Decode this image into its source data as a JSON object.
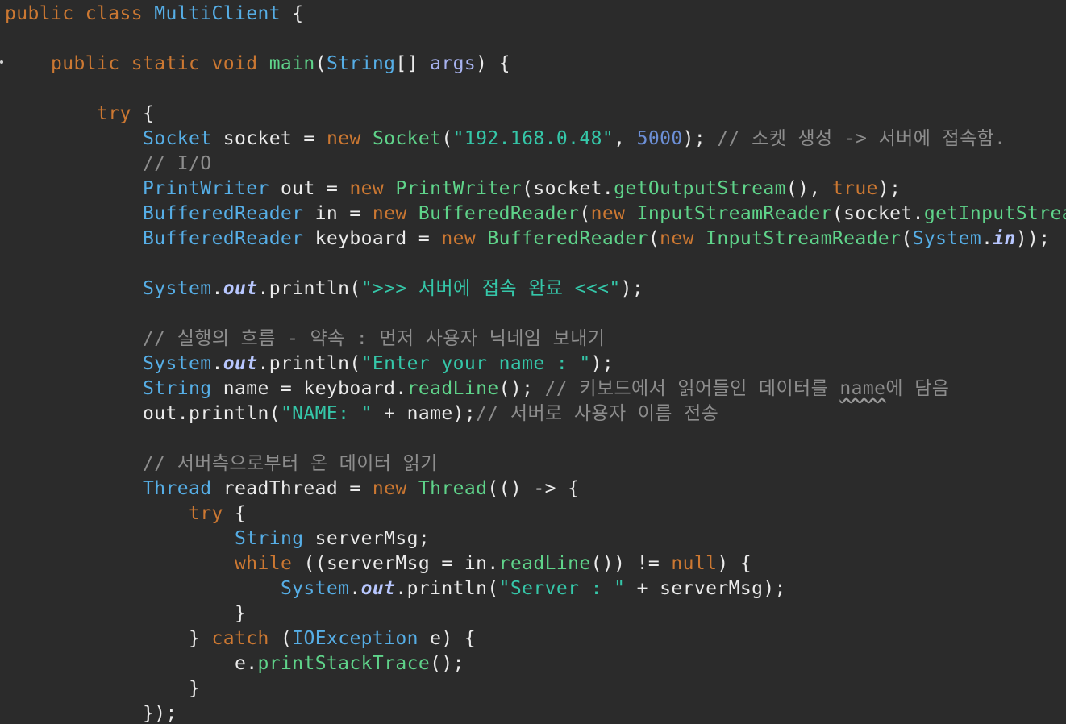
{
  "editor": {
    "lines": [
      [
        {
          "t": "public class ",
          "c": "kw"
        },
        {
          "t": "MultiClient",
          "c": "cls"
        },
        {
          "t": " {",
          "c": "plain"
        }
      ],
      [],
      [
        {
          "t": "    public static void ",
          "c": "kw"
        },
        {
          "t": "main",
          "c": "fn"
        },
        {
          "t": "(",
          "c": "plain"
        },
        {
          "t": "String",
          "c": "cls"
        },
        {
          "t": "[] ",
          "c": "plain"
        },
        {
          "t": "args",
          "c": "param"
        },
        {
          "t": ") {",
          "c": "plain"
        }
      ],
      [],
      [
        {
          "t": "        try",
          "c": "kw"
        },
        {
          "t": " {",
          "c": "plain"
        }
      ],
      [
        {
          "t": "            ",
          "c": "plain"
        },
        {
          "t": "Socket",
          "c": "cls"
        },
        {
          "t": " socket = ",
          "c": "plain"
        },
        {
          "t": "new ",
          "c": "kw"
        },
        {
          "t": "Socket",
          "c": "mth"
        },
        {
          "t": "(",
          "c": "plain"
        },
        {
          "t": "\"192.168.0.48\"",
          "c": "str"
        },
        {
          "t": ", ",
          "c": "plain"
        },
        {
          "t": "5000",
          "c": "num"
        },
        {
          "t": "); ",
          "c": "plain"
        },
        {
          "t": "// 소켓 생성 -> 서버에 접속함.",
          "c": "cmt"
        }
      ],
      [
        {
          "t": "            ",
          "c": "plain"
        },
        {
          "t": "// I/O",
          "c": "cmt"
        }
      ],
      [
        {
          "t": "            ",
          "c": "plain"
        },
        {
          "t": "PrintWriter",
          "c": "cls"
        },
        {
          "t": " out = ",
          "c": "plain"
        },
        {
          "t": "new ",
          "c": "kw"
        },
        {
          "t": "PrintWriter",
          "c": "mth"
        },
        {
          "t": "(socket.",
          "c": "plain"
        },
        {
          "t": "getOutputStream",
          "c": "mth"
        },
        {
          "t": "(), ",
          "c": "plain"
        },
        {
          "t": "true",
          "c": "kw"
        },
        {
          "t": ");",
          "c": "plain"
        }
      ],
      [
        {
          "t": "            ",
          "c": "plain"
        },
        {
          "t": "BufferedReader",
          "c": "cls"
        },
        {
          "t": " in = ",
          "c": "plain"
        },
        {
          "t": "new ",
          "c": "kw"
        },
        {
          "t": "BufferedReader",
          "c": "mth"
        },
        {
          "t": "(",
          "c": "plain"
        },
        {
          "t": "new ",
          "c": "kw"
        },
        {
          "t": "InputStreamReader",
          "c": "mth"
        },
        {
          "t": "(socket.",
          "c": "plain"
        },
        {
          "t": "getInputStream",
          "c": "mth"
        },
        {
          "t": "()));",
          "c": "plain"
        }
      ],
      [
        {
          "t": "            ",
          "c": "plain"
        },
        {
          "t": "BufferedReader",
          "c": "cls"
        },
        {
          "t": " keyboard = ",
          "c": "plain"
        },
        {
          "t": "new ",
          "c": "kw"
        },
        {
          "t": "BufferedReader",
          "c": "mth"
        },
        {
          "t": "(",
          "c": "plain"
        },
        {
          "t": "new ",
          "c": "kw"
        },
        {
          "t": "InputStreamReader",
          "c": "mth"
        },
        {
          "t": "(",
          "c": "plain"
        },
        {
          "t": "System",
          "c": "cls"
        },
        {
          "t": ".",
          "c": "plain"
        },
        {
          "t": "in",
          "c": "sfield"
        },
        {
          "t": "));",
          "c": "plain"
        }
      ],
      [],
      [
        {
          "t": "            ",
          "c": "plain"
        },
        {
          "t": "System",
          "c": "cls"
        },
        {
          "t": ".",
          "c": "plain"
        },
        {
          "t": "out",
          "c": "sfield"
        },
        {
          "t": ".println(",
          "c": "plain"
        },
        {
          "t": "\">>> 서버에 접속 완료 <<<\"",
          "c": "str"
        },
        {
          "t": ");",
          "c": "plain"
        }
      ],
      [],
      [
        {
          "t": "            ",
          "c": "plain"
        },
        {
          "t": "// 실행의 흐름 - 약속 : 먼저 사용자 닉네임 보내기",
          "c": "cmt"
        }
      ],
      [
        {
          "t": "            ",
          "c": "plain"
        },
        {
          "t": "System",
          "c": "cls"
        },
        {
          "t": ".",
          "c": "plain"
        },
        {
          "t": "out",
          "c": "sfield"
        },
        {
          "t": ".println(",
          "c": "plain"
        },
        {
          "t": "\"Enter your name : \"",
          "c": "str"
        },
        {
          "t": ");",
          "c": "plain"
        }
      ],
      [
        {
          "t": "            ",
          "c": "plain"
        },
        {
          "t": "String",
          "c": "cls"
        },
        {
          "t": " name = keyboard.",
          "c": "plain"
        },
        {
          "t": "readLine",
          "c": "mth"
        },
        {
          "t": "(); ",
          "c": "plain"
        },
        {
          "t": "// 키보드에서 읽어들인 데이터를 ",
          "c": "cmt"
        },
        {
          "t": "name",
          "c": "cmt warn"
        },
        {
          "t": "에 담음",
          "c": "cmt"
        }
      ],
      [
        {
          "t": "            ",
          "c": "plain"
        },
        {
          "t": "out.println(",
          "c": "plain"
        },
        {
          "t": "\"NAME: \"",
          "c": "str"
        },
        {
          "t": " + name);",
          "c": "plain"
        },
        {
          "t": "// 서버로 사용자 이름 전송",
          "c": "cmt"
        }
      ],
      [],
      [
        {
          "t": "            ",
          "c": "plain"
        },
        {
          "t": "// 서버측으로부터 온 데이터 읽기",
          "c": "cmt"
        }
      ],
      [
        {
          "t": "            ",
          "c": "plain"
        },
        {
          "t": "Thread",
          "c": "cls"
        },
        {
          "t": " readThread = ",
          "c": "plain"
        },
        {
          "t": "new ",
          "c": "kw"
        },
        {
          "t": "Thread",
          "c": "mth"
        },
        {
          "t": "(() -> {",
          "c": "plain"
        }
      ],
      [
        {
          "t": "                ",
          "c": "plain"
        },
        {
          "t": "try",
          "c": "kw"
        },
        {
          "t": " {",
          "c": "plain"
        }
      ],
      [
        {
          "t": "                    ",
          "c": "plain"
        },
        {
          "t": "String",
          "c": "cls"
        },
        {
          "t": " serverMsg;",
          "c": "plain"
        }
      ],
      [
        {
          "t": "                    ",
          "c": "plain"
        },
        {
          "t": "while",
          "c": "kw"
        },
        {
          "t": " ((serverMsg = in.",
          "c": "plain"
        },
        {
          "t": "readLine",
          "c": "mth"
        },
        {
          "t": "()) != ",
          "c": "plain"
        },
        {
          "t": "null",
          "c": "kw"
        },
        {
          "t": ") {",
          "c": "plain"
        }
      ],
      [
        {
          "t": "                        ",
          "c": "plain"
        },
        {
          "t": "System",
          "c": "cls"
        },
        {
          "t": ".",
          "c": "plain"
        },
        {
          "t": "out",
          "c": "sfield"
        },
        {
          "t": ".println(",
          "c": "plain"
        },
        {
          "t": "\"Server : \"",
          "c": "str"
        },
        {
          "t": " + serverMsg);",
          "c": "plain"
        }
      ],
      [
        {
          "t": "                    }",
          "c": "plain"
        }
      ],
      [
        {
          "t": "                } ",
          "c": "plain"
        },
        {
          "t": "catch",
          "c": "kw"
        },
        {
          "t": " (",
          "c": "plain"
        },
        {
          "t": "IOException",
          "c": "cls"
        },
        {
          "t": " e) {",
          "c": "plain"
        }
      ],
      [
        {
          "t": "                    e.",
          "c": "plain"
        },
        {
          "t": "printStackTrace",
          "c": "mth"
        },
        {
          "t": "();",
          "c": "plain"
        }
      ],
      [
        {
          "t": "                }",
          "c": "plain"
        }
      ],
      [
        {
          "t": "            });",
          "c": "plain"
        }
      ]
    ]
  }
}
